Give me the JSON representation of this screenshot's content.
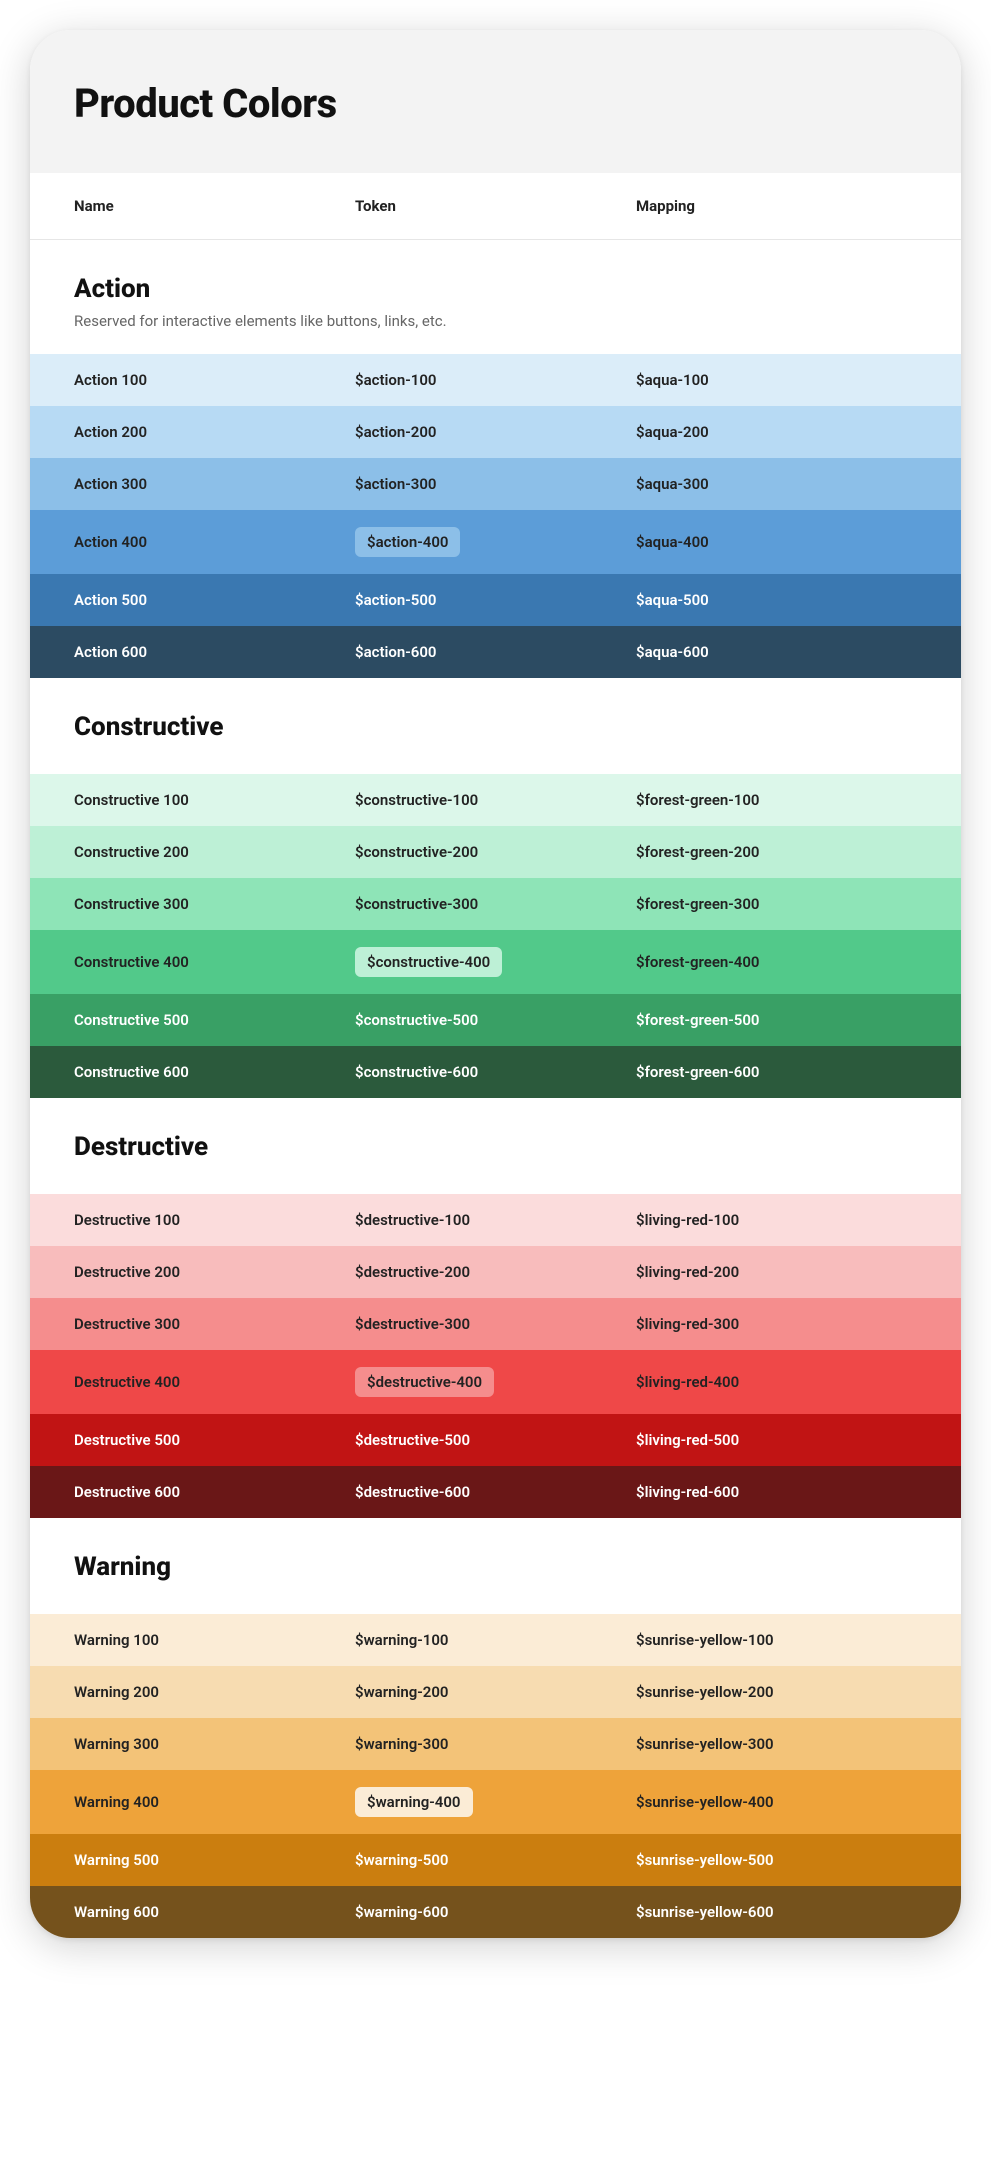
{
  "title": "Product Colors",
  "columns": {
    "name": "Name",
    "token": "Token",
    "mapping": "Mapping"
  },
  "groups": [
    {
      "title": "Action",
      "subtitle": "Reserved for interactive elements like buttons, links, etc.",
      "rows": [
        {
          "name": "Action 100",
          "token": "$action-100",
          "mapping": "$aqua-100",
          "bg": "#dbedf9",
          "text": "dark",
          "default": false
        },
        {
          "name": "Action 200",
          "token": "$action-200",
          "mapping": "$aqua-200",
          "bg": "#b7daf4",
          "text": "dark",
          "default": false
        },
        {
          "name": "Action 300",
          "token": "$action-300",
          "mapping": "$aqua-300",
          "bg": "#8cbfe8",
          "text": "dark",
          "default": false
        },
        {
          "name": "Action 400",
          "token": "$action-400",
          "mapping": "$aqua-400",
          "bg": "#5c9dd8",
          "text": "dark",
          "default": true,
          "pillBg": "#8cbfe8"
        },
        {
          "name": "Action 500",
          "token": "$action-500",
          "mapping": "$aqua-500",
          "bg": "#3a78b1",
          "text": "light",
          "default": false
        },
        {
          "name": "Action 600",
          "token": "$action-600",
          "mapping": "$aqua-600",
          "bg": "#2c4b62",
          "text": "light",
          "default": false
        }
      ]
    },
    {
      "title": "Constructive",
      "subtitle": "",
      "rows": [
        {
          "name": "Constructive 100",
          "token": "$constructive-100",
          "mapping": "$forest-green-100",
          "bg": "#dcf7ea",
          "text": "dark",
          "default": false
        },
        {
          "name": "Constructive 200",
          "token": "$constructive-200",
          "mapping": "$forest-green-200",
          "bg": "#bdf0d6",
          "text": "dark",
          "default": false
        },
        {
          "name": "Constructive 300",
          "token": "$constructive-300",
          "mapping": "$forest-green-300",
          "bg": "#8ee4b7",
          "text": "dark",
          "default": false
        },
        {
          "name": "Constructive 400",
          "token": "$constructive-400",
          "mapping": "$forest-green-400",
          "bg": "#52c98a",
          "text": "dark",
          "default": true,
          "pillBg": "#bdf0d6"
        },
        {
          "name": "Constructive 500",
          "token": "$constructive-500",
          "mapping": "$forest-green-500",
          "bg": "#39a065",
          "text": "light",
          "default": false
        },
        {
          "name": "Constructive 600",
          "token": "$constructive-600",
          "mapping": "$forest-green-600",
          "bg": "#2b5a3c",
          "text": "light",
          "default": false
        }
      ]
    },
    {
      "title": "Destructive",
      "subtitle": "",
      "rows": [
        {
          "name": "Destructive 100",
          "token": "$destructive-100",
          "mapping": "$living-red-100",
          "bg": "#fbdcdc",
          "text": "dark",
          "default": false
        },
        {
          "name": "Destructive 200",
          "token": "$destructive-200",
          "mapping": "$living-red-200",
          "bg": "#f8bcbc",
          "text": "dark",
          "default": false
        },
        {
          "name": "Destructive 300",
          "token": "$destructive-300",
          "mapping": "$living-red-300",
          "bg": "#f58d8d",
          "text": "dark",
          "default": false
        },
        {
          "name": "Destructive 400",
          "token": "$destructive-400",
          "mapping": "$living-red-400",
          "bg": "#ef4848",
          "text": "dark",
          "default": true,
          "pillBg": "#f58d8d"
        },
        {
          "name": "Destructive 500",
          "token": "$destructive-500",
          "mapping": "$living-red-500",
          "bg": "#c11414",
          "text": "light",
          "default": false
        },
        {
          "name": "Destructive 600",
          "token": "$destructive-600",
          "mapping": "$living-red-600",
          "bg": "#6a1717",
          "text": "light",
          "default": false
        }
      ]
    },
    {
      "title": "Warning",
      "subtitle": "",
      "rows": [
        {
          "name": "Warning 100",
          "token": "$warning-100",
          "mapping": "$sunrise-yellow-100",
          "bg": "#fbecd6",
          "text": "dark",
          "default": false
        },
        {
          "name": "Warning 200",
          "token": "$warning-200",
          "mapping": "$sunrise-yellow-200",
          "bg": "#f7dcb1",
          "text": "dark",
          "default": false
        },
        {
          "name": "Warning 300",
          "token": "$warning-300",
          "mapping": "$sunrise-yellow-300",
          "bg": "#f3c378",
          "text": "dark",
          "default": false
        },
        {
          "name": "Warning 400",
          "token": "$warning-400",
          "mapping": "$sunrise-yellow-400",
          "bg": "#eea33a",
          "text": "dark",
          "default": true,
          "pillBg": "#fbecd6"
        },
        {
          "name": "Warning 500",
          "token": "$warning-500",
          "mapping": "$sunrise-yellow-500",
          "bg": "#cb7e0f",
          "text": "light",
          "default": false
        },
        {
          "name": "Warning 600",
          "token": "$warning-600",
          "mapping": "$sunrise-yellow-600",
          "bg": "#75521c",
          "text": "light",
          "default": false
        }
      ]
    }
  ]
}
